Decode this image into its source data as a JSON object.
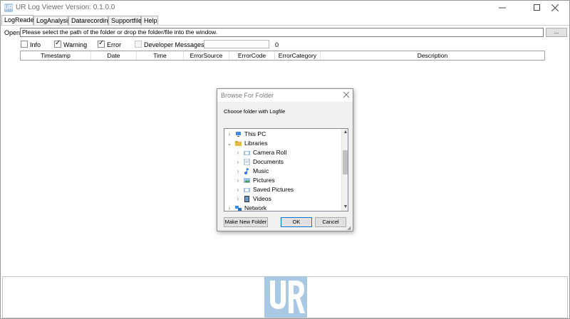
{
  "window": {
    "title": "UR Log Viewer Version: 0.1.0.0"
  },
  "tabs": [
    "LogReader",
    "LogAnalysis",
    "Datarecording",
    "Supportfile",
    "Help"
  ],
  "open_row": {
    "label": "Open",
    "path_placeholder": "Please select the path of the folder or drop the folder/file into the window.",
    "browse_label": "..."
  },
  "filters": {
    "info": {
      "label": "Info",
      "checked": false
    },
    "warning": {
      "label": "Warning",
      "checked": true
    },
    "error": {
      "label": "Error",
      "checked": true
    },
    "developer": {
      "label": "Developer Messages",
      "checked": false
    },
    "count": "0"
  },
  "table": {
    "columns": [
      "Timestamp",
      "Date",
      "Time",
      "ErrorSource",
      "ErrorCode",
      "ErrorCategory",
      "Description"
    ]
  },
  "dialog": {
    "title": "Browse For Folder",
    "prompt": "Choose folder with Logfile",
    "tree": [
      {
        "label": "This PC",
        "icon": "computer-icon",
        "expanded": false
      },
      {
        "label": "Libraries",
        "icon": "libraries-folder-icon",
        "expanded": true
      },
      {
        "label": "Camera Roll",
        "icon": "library-icon",
        "expanded": false
      },
      {
        "label": "Documents",
        "icon": "documents-icon",
        "expanded": false
      },
      {
        "label": "Music",
        "icon": "music-icon",
        "expanded": false
      },
      {
        "label": "Pictures",
        "icon": "pictures-icon",
        "expanded": false
      },
      {
        "label": "Saved Pictures",
        "icon": "library-icon",
        "expanded": false
      },
      {
        "label": "Videos",
        "icon": "videos-icon",
        "expanded": false
      },
      {
        "label": "Network",
        "icon": "network-icon",
        "expanded": false
      }
    ],
    "buttons": {
      "make_new_folder": "Make New Folder",
      "ok": "OK",
      "cancel": "Cancel"
    }
  },
  "logo": {
    "text": "UR",
    "color": "#a9c8e4"
  }
}
